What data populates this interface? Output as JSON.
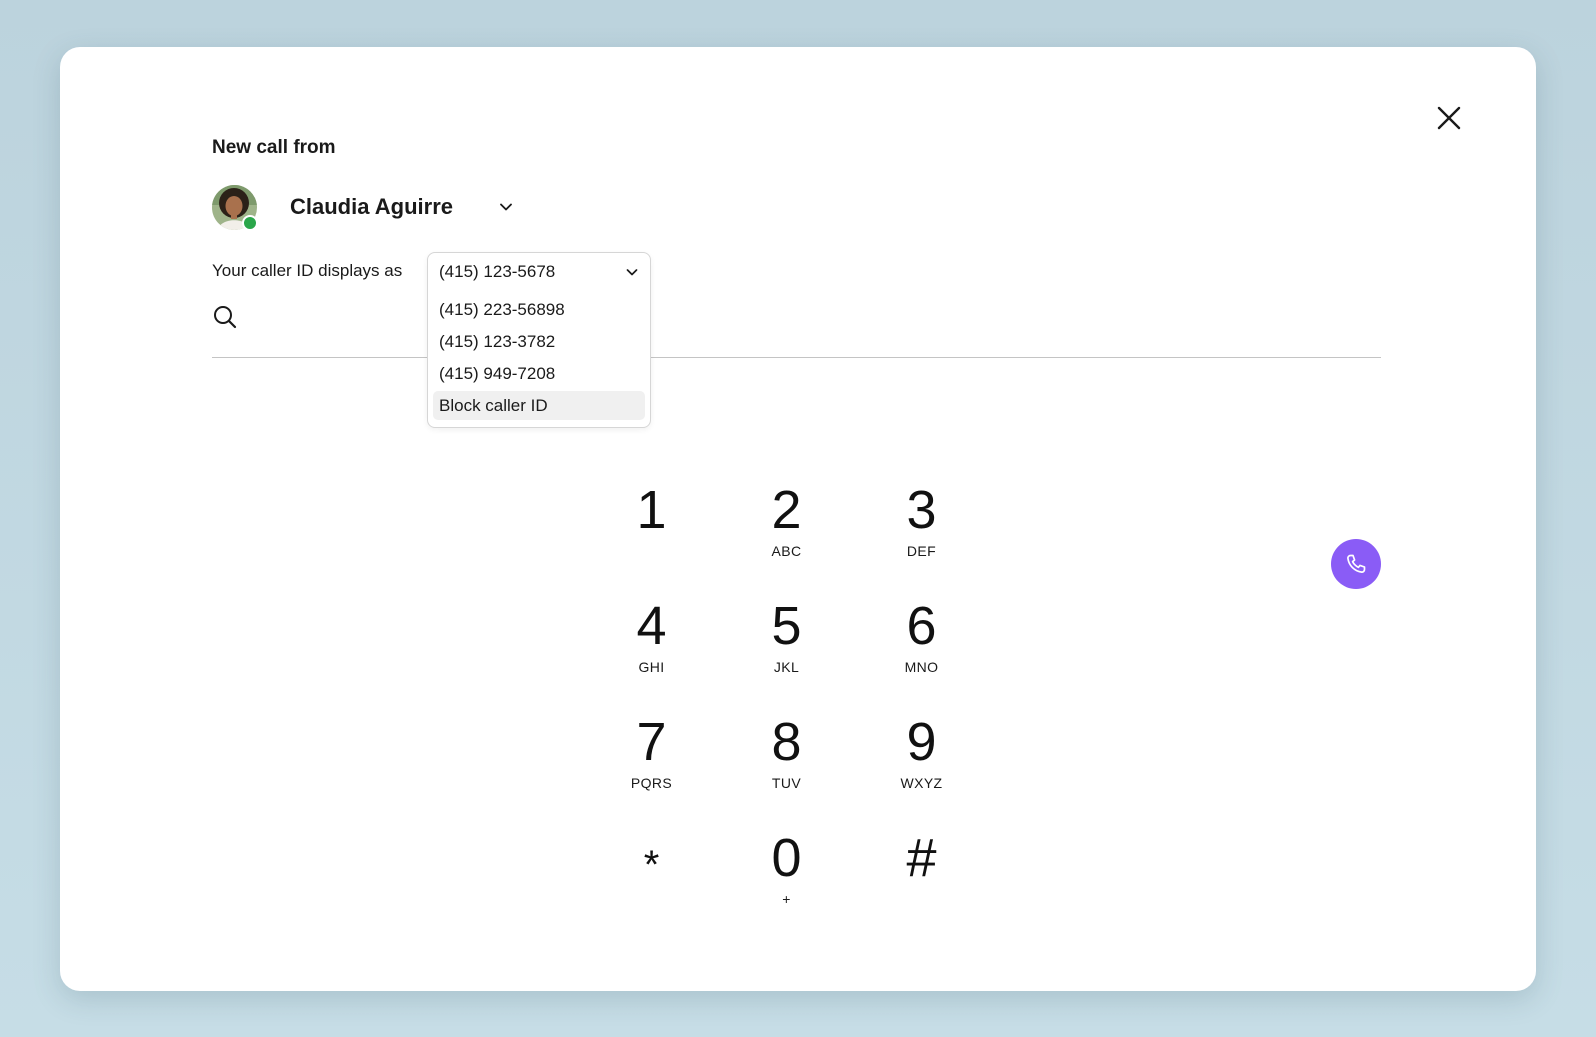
{
  "dialog": {
    "from_label": "New call from",
    "close_icon": "close-icon"
  },
  "caller": {
    "name": "Claudia Aguirre",
    "status": "online",
    "status_color": "#2aa64a",
    "chevron_icon": "chevron-down-icon"
  },
  "caller_id": {
    "label": "Your caller ID displays as",
    "selected": "(415) 123-5678",
    "options": [
      "(415) 223-56898",
      "(415) 123-3782",
      "(415) 949-7208",
      "Block caller ID"
    ],
    "highlighted_option": "Block caller ID"
  },
  "search": {
    "placeholder": "",
    "value": "",
    "icon": "search-icon"
  },
  "call_button": {
    "icon": "phone-icon",
    "color": "#8a5cf6"
  },
  "keypad": {
    "keys": [
      {
        "digit": "1",
        "letters": ""
      },
      {
        "digit": "2",
        "letters": "ABC"
      },
      {
        "digit": "3",
        "letters": "DEF"
      },
      {
        "digit": "4",
        "letters": "GHI"
      },
      {
        "digit": "5",
        "letters": "JKL"
      },
      {
        "digit": "6",
        "letters": "MNO"
      },
      {
        "digit": "7",
        "letters": "PQRS"
      },
      {
        "digit": "8",
        "letters": "TUV"
      },
      {
        "digit": "9",
        "letters": "WXYZ"
      },
      {
        "digit": "*",
        "letters": ""
      },
      {
        "digit": "0",
        "letters": "+"
      },
      {
        "digit": "#",
        "letters": ""
      }
    ]
  }
}
